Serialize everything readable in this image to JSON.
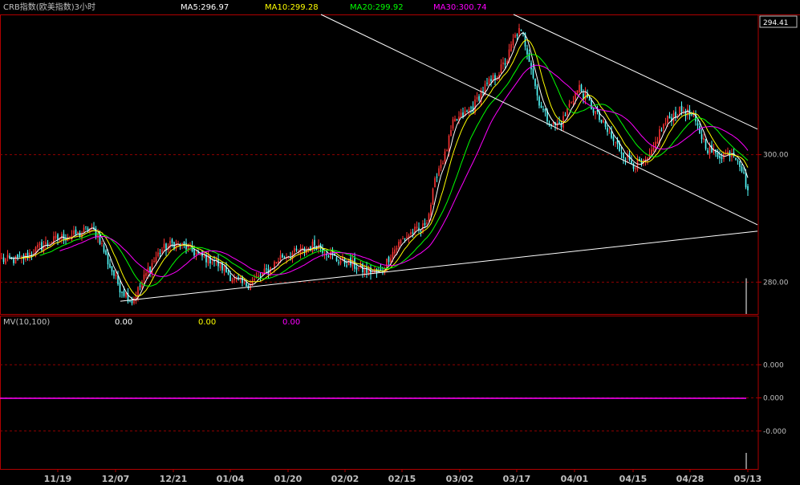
{
  "header": {
    "title": "CRB指数(欧美指数)3小时",
    "ma_labels": [
      {
        "text": "MA5:296.97",
        "color": "#ffffff"
      },
      {
        "text": "MA10:299.28",
        "color": "#ffff00"
      },
      {
        "text": "MA20:299.92",
        "color": "#00ff00"
      },
      {
        "text": "MA30:300.74",
        "color": "#ff00ff"
      }
    ]
  },
  "price_tag": "294.41",
  "volume_header": {
    "label": "MV(10,100)",
    "values": [
      "0.00",
      "0.00",
      "0.00"
    ],
    "colors": [
      "#ffffff",
      "#ffff00",
      "#ff00ff"
    ]
  },
  "colors": {
    "background": "#000000",
    "frame": "#b00000",
    "grid": "#900000",
    "up": "#ff3232",
    "down": "#54ffff",
    "label_text": "#c0c0c0",
    "date_text": "#c0c0c0",
    "trendline": "#ffffff",
    "ma5": "#ffffff",
    "ma10": "#ffff00",
    "ma20": "#00ff00",
    "ma30": "#ff00ff"
  },
  "chart_data": [
    {
      "type": "candlestick",
      "title": "CRB指数(欧美指数)3小时",
      "x_tick_labels": [
        "11/19",
        "12/07",
        "12/21",
        "01/04",
        "01/20",
        "02/02",
        "02/15",
        "03/02",
        "03/17",
        "04/01",
        "04/15",
        "04/28",
        "05/13"
      ],
      "y_tick_labels": [
        "300.00",
        "280.00"
      ],
      "ylim": [
        275,
        322
      ],
      "latest_value": 294.41,
      "close_anchors": [
        [
          0,
          283.5
        ],
        [
          25,
          283.5
        ],
        [
          50,
          285.5
        ],
        [
          75,
          287.0
        ],
        [
          100,
          287.5
        ],
        [
          110,
          288.5
        ],
        [
          122,
          287.5
        ],
        [
          135,
          283.0
        ],
        [
          150,
          279.0
        ],
        [
          165,
          277.0
        ],
        [
          185,
          282.0
        ],
        [
          200,
          285.0
        ],
        [
          215,
          286.0
        ],
        [
          232,
          285.5
        ],
        [
          250,
          284.0
        ],
        [
          265,
          283.5
        ],
        [
          280,
          282.0
        ],
        [
          290,
          280.5
        ],
        [
          305,
          279.5
        ],
        [
          320,
          280.5
        ],
        [
          335,
          282.0
        ],
        [
          350,
          284.0
        ],
        [
          365,
          284.5
        ],
        [
          380,
          285.0
        ],
        [
          393,
          286.0
        ],
        [
          405,
          285.0
        ],
        [
          420,
          283.5
        ],
        [
          435,
          283.0
        ],
        [
          450,
          282.0
        ],
        [
          465,
          281.5
        ],
        [
          475,
          281.5
        ],
        [
          485,
          284.0
        ],
        [
          500,
          286.5
        ],
        [
          515,
          288.0
        ],
        [
          525,
          288.0
        ],
        [
          535,
          291.0
        ],
        [
          545,
          297.5
        ],
        [
          555,
          300.0
        ],
        [
          565,
          305.0
        ],
        [
          575,
          306.0
        ],
        [
          590,
          307.5
        ],
        [
          600,
          310.0
        ],
        [
          612,
          311.5
        ],
        [
          622,
          313.0
        ],
        [
          632,
          315.0
        ],
        [
          640,
          318.0
        ],
        [
          646,
          319.5
        ],
        [
          652,
          318.5
        ],
        [
          660,
          315.0
        ],
        [
          670,
          309.0
        ],
        [
          680,
          306.0
        ],
        [
          690,
          304.5
        ],
        [
          700,
          305.0
        ],
        [
          712,
          308.5
        ],
        [
          722,
          310.5
        ],
        [
          732,
          308.5
        ],
        [
          745,
          306.0
        ],
        [
          755,
          304.0
        ],
        [
          765,
          302.0
        ],
        [
          778,
          300.0
        ],
        [
          790,
          298.5
        ],
        [
          803,
          298.5
        ],
        [
          812,
          300.0
        ],
        [
          822,
          303.5
        ],
        [
          832,
          305.5
        ],
        [
          842,
          306.5
        ],
        [
          852,
          307.0
        ],
        [
          862,
          306.0
        ],
        [
          872,
          303.5
        ],
        [
          882,
          301.0
        ],
        [
          892,
          300.0
        ],
        [
          902,
          300.0
        ],
        [
          912,
          300.5
        ],
        [
          920,
          299.5
        ],
        [
          925,
          297.5
        ],
        [
          932,
          294.4
        ]
      ],
      "moving_averages": [
        {
          "name": "MA5",
          "period": 5,
          "latest": 296.97
        },
        {
          "name": "MA10",
          "period": 10,
          "latest": 299.28
        },
        {
          "name": "MA20",
          "period": 20,
          "latest": 299.92
        },
        {
          "name": "MA30",
          "period": 30,
          "latest": 300.74
        }
      ],
      "trendlines": [
        {
          "from": [
            150,
            277.0
          ],
          "to": [
            944,
            288.0
          ]
        },
        {
          "from": [
            400,
            322.0
          ],
          "to": [
            944,
            289.0
          ]
        },
        {
          "from": [
            640,
            322.0
          ],
          "to": [
            944,
            304.0
          ]
        }
      ]
    },
    {
      "type": "bar",
      "title": "MV(10,100)",
      "y_tick_labels": [
        "0.000",
        "0.000",
        "-0.000"
      ],
      "ylim": [
        -1,
        1
      ],
      "values": [
        0.0,
        0.0,
        0.0
      ]
    }
  ]
}
